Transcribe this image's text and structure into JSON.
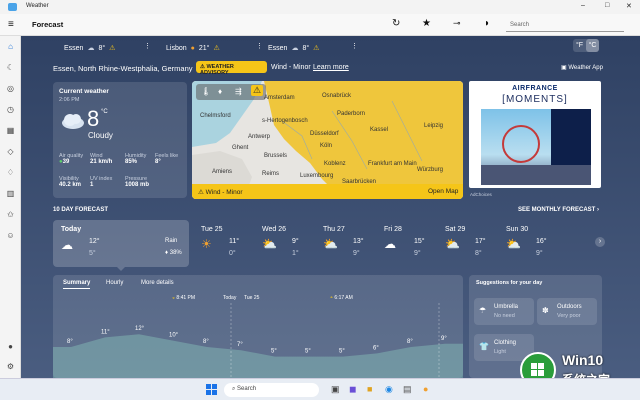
{
  "window": {
    "title": "Weather"
  },
  "header": {
    "title": "Forecast",
    "search_placeholder": "Search"
  },
  "favorites": [
    {
      "city": "Essen",
      "temp": "8°",
      "alert": true
    },
    {
      "city": "Lisbon",
      "temp": "21°",
      "alert": true
    },
    {
      "city": "Essen",
      "temp": "8°",
      "alert": true
    }
  ],
  "units": {
    "f": "°F",
    "c": "°C"
  },
  "location": {
    "name": "Essen, North Rhine-Westphalia, Germany",
    "advisory": "WEATHER ADVISORY",
    "wind": "Wind - Minor",
    "learn_more": "Learn more",
    "weather_app": "Weather App"
  },
  "current": {
    "heading": "Current weather",
    "time": "2:06 PM",
    "temp": "8",
    "unit": "°C",
    "condition": "Cloudy",
    "metrics": [
      {
        "label": "Air quality",
        "value": "39"
      },
      {
        "label": "Wind",
        "value": "21 km/h"
      },
      {
        "label": "Humidity",
        "value": "85%"
      },
      {
        "label": "Feels like",
        "value": "8°"
      },
      {
        "label": "Visibility",
        "value": "40.2 km"
      },
      {
        "label": "UV index",
        "value": "1"
      },
      {
        "label": "Pressure",
        "value": "1008 mb"
      }
    ]
  },
  "map": {
    "cities": [
      "Amsterdam",
      "Osnabrück",
      "Chelmsford",
      "s-Hertogenbosch",
      "Paderborn",
      "Düsseldorf",
      "Kassel",
      "Leipzig",
      "Antwerp",
      "Köln",
      "Ghent",
      "Brussels",
      "Koblenz",
      "Frankfurt am Main",
      "Würzburg",
      "Reims",
      "Amiens",
      "Saarbrücken",
      "Luxembourg"
    ],
    "alert": "Wind - Minor",
    "open": "Open Map"
  },
  "ad": {
    "brand": "AIRFRANCE",
    "title": "MOMENTS",
    "choices": "AdChoices"
  },
  "forecast": {
    "heading": "10 DAY FORECAST",
    "see_more": "SEE MONTHLY FORECAST",
    "days": [
      {
        "day": "Today",
        "high": "12°",
        "low": "5°",
        "extra": "Rain",
        "pct": "38%"
      },
      {
        "day": "Tue 25",
        "high": "11°",
        "low": "0°"
      },
      {
        "day": "Wed 26",
        "high": "9°",
        "low": "1°"
      },
      {
        "day": "Thu 27",
        "high": "13°",
        "low": "9°"
      },
      {
        "day": "Fri 28",
        "high": "15°",
        "low": "9°"
      },
      {
        "day": "Sat 29",
        "high": "17°",
        "low": "8°"
      },
      {
        "day": "Sun 30",
        "high": "16°",
        "low": "9°"
      }
    ]
  },
  "detail": {
    "tabs": [
      "Summary",
      "Hourly",
      "More details"
    ],
    "markers": [
      {
        "time": "8:41 PM"
      },
      {
        "time": "Today"
      },
      {
        "time": "Tue 25"
      },
      {
        "time": "6:17 AM"
      }
    ],
    "temps": [
      "8°",
      "11°",
      "12°",
      "10°",
      "8°",
      "7°",
      "5°",
      "5°",
      "5°",
      "6°",
      "8°",
      "9°"
    ]
  },
  "suggestions": {
    "heading": "Suggestions for your day",
    "items": [
      {
        "label": "Umbrella",
        "value": "No need"
      },
      {
        "label": "Outdoors",
        "value": "Very poor"
      },
      {
        "label": "Clothing",
        "value": "Light"
      }
    ]
  },
  "taskbar": {
    "search": "Search"
  },
  "watermark": {
    "brand": "Win10",
    "site": "系统之家"
  },
  "colors": {
    "alert": "#f5c518",
    "map_yellow": "#f0c32e",
    "panel": "#3b4d6e"
  }
}
